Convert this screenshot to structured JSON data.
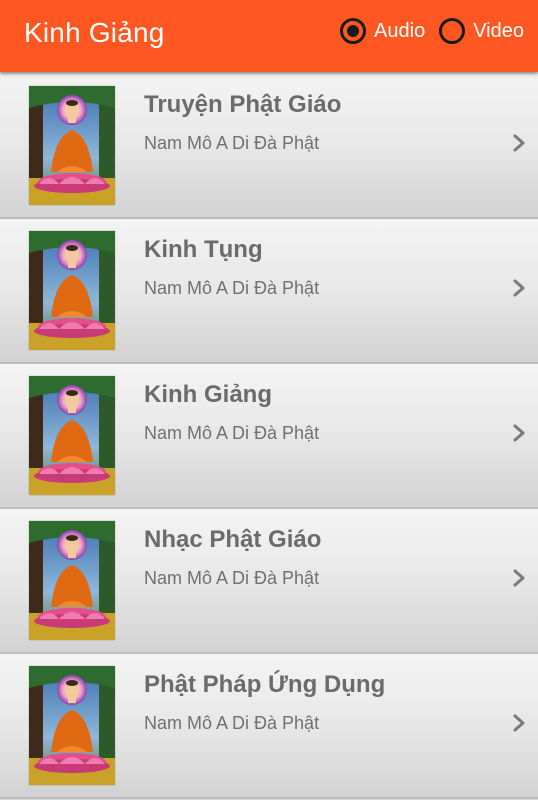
{
  "appbar": {
    "title": "Kinh Giảng",
    "options": [
      {
        "label": "Audio",
        "selected": true
      },
      {
        "label": "Video",
        "selected": false
      }
    ],
    "color": "#ff5722"
  },
  "items": [
    {
      "title": "Truyện Phật Giáo",
      "subtitle": "Nam Mô A Di Đà Phật",
      "icon": "buddha-image"
    },
    {
      "title": "Kinh Tụng",
      "subtitle": "Nam Mô A Di Đà Phật",
      "icon": "buddha-image"
    },
    {
      "title": "Kinh Giảng",
      "subtitle": "Nam Mô A Di Đà Phật",
      "icon": "buddha-image"
    },
    {
      "title": "Nhạc Phật Giáo",
      "subtitle": "Nam Mô A Di Đà Phật",
      "icon": "buddha-image"
    },
    {
      "title": "Phật Pháp Ứng Dụng",
      "subtitle": "Nam Mô A Di Đà Phật",
      "icon": "buddha-image"
    }
  ]
}
